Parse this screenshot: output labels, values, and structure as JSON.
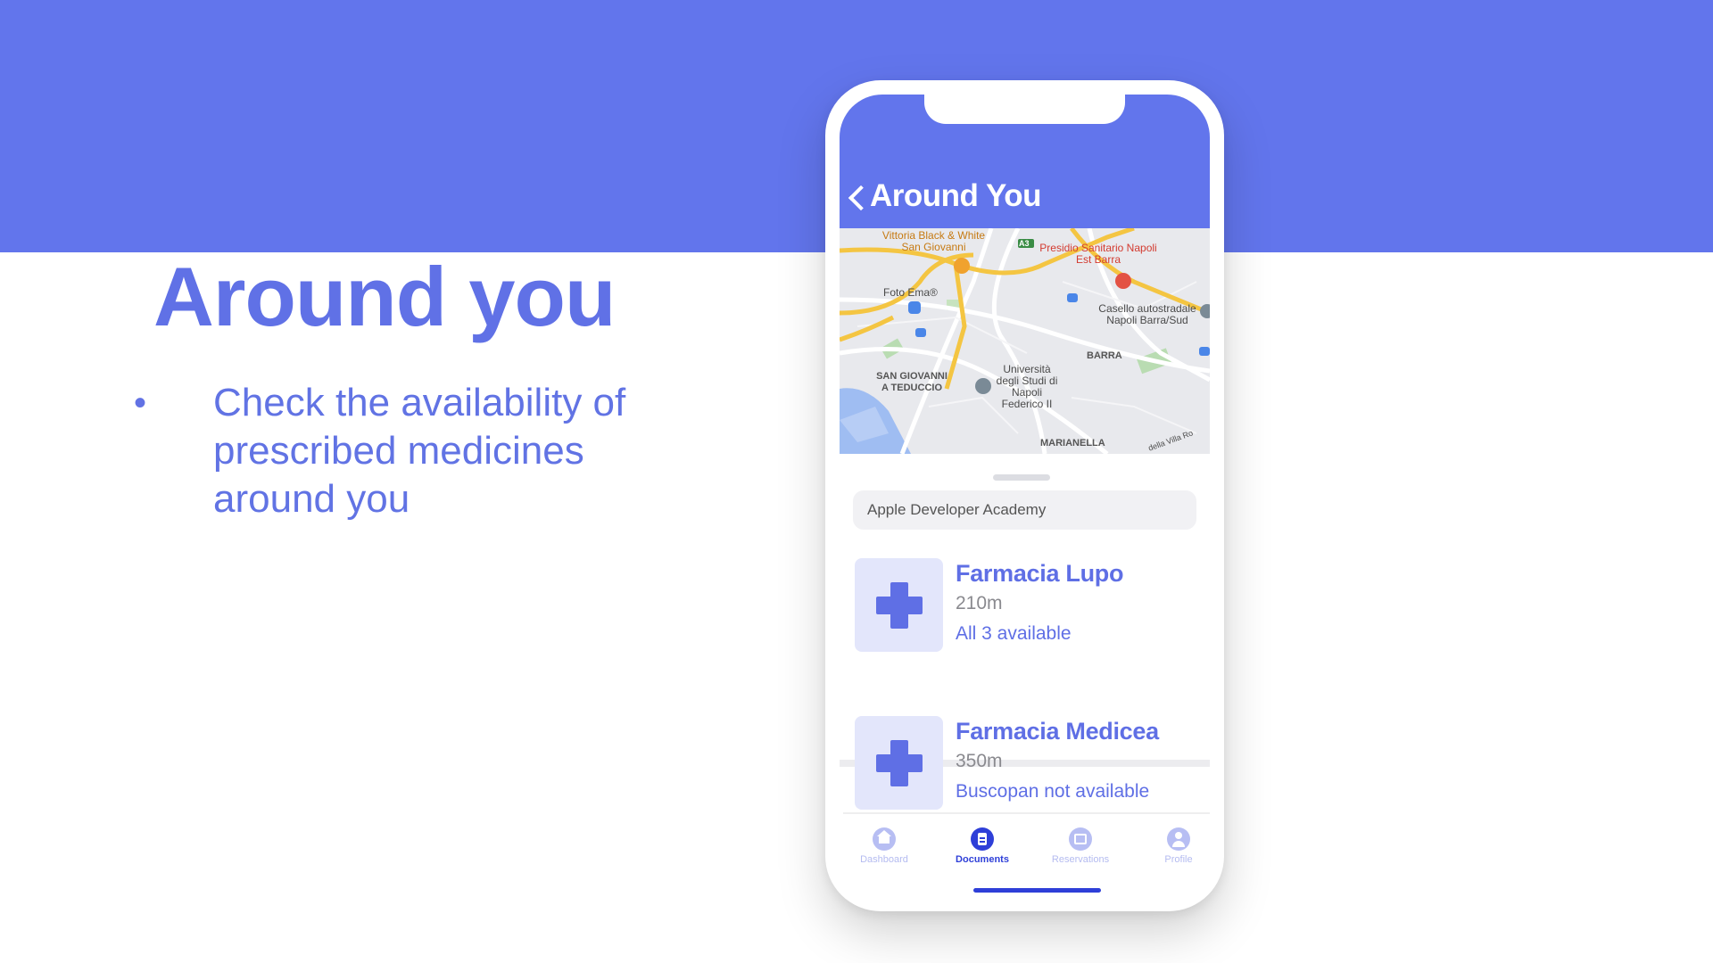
{
  "slide": {
    "title": "Around you",
    "bullet_marker": "•",
    "bullet_text": "Check the availability of prescribed medicines around you"
  },
  "app": {
    "header_title": "Around You",
    "map_labels": {
      "vittoria_black": "Vittoria Black & White San Giovanni",
      "presidio": "Presidio Sanitario Napoli Est Barra",
      "foto_ema": "Foto Ema®",
      "casello": "Casello autostradale Napoli Barra/Sud",
      "barra": "BARRA",
      "san_giovanni": "SAN GIOVANNI A TEDUCCIO",
      "universita": "Università degli Studi di Napoli Federico II",
      "marianella": "MARIANELLA",
      "via_villa": "della Villa Ro",
      "a3_shield": "A3"
    },
    "search_value": "Apple Developer Academy",
    "pharmacies": [
      {
        "name": "Farmacia Lupo",
        "distance": "210m",
        "availability": "All 3 available"
      },
      {
        "name": "Farmacia Medicea",
        "distance": "350m",
        "availability": "Buscopan not available"
      }
    ],
    "tabs": [
      {
        "label": "Dashboard",
        "icon": "house-icon",
        "active": false
      },
      {
        "label": "Documents",
        "icon": "document-icon",
        "active": true
      },
      {
        "label": "Reservations",
        "icon": "calendar-icon",
        "active": false
      },
      {
        "label": "Profile",
        "icon": "person-icon",
        "active": false
      }
    ]
  },
  "colors": {
    "brand": "#6275ec",
    "accent_text": "#5f6fe5",
    "tab_active": "#2e3fd8",
    "tab_inactive": "#b7bef3",
    "icon_tile": "#e3e6fb"
  }
}
